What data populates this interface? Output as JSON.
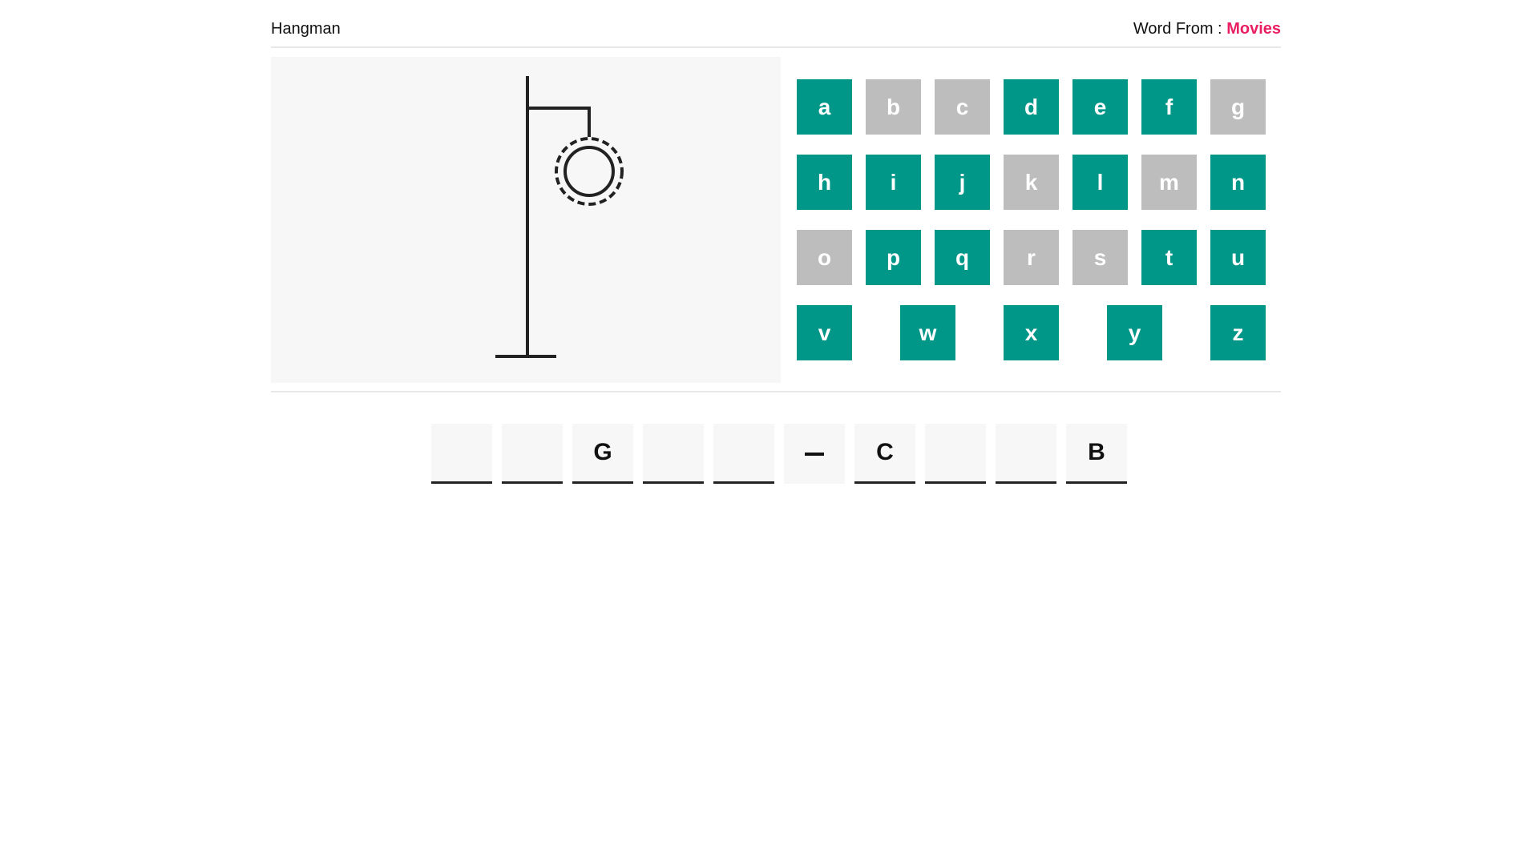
{
  "header": {
    "title": "Hangman",
    "category_label": "Word From :",
    "category_value": "Movies"
  },
  "colors": {
    "key_available": "#009688",
    "key_used": "#bdbdbd",
    "category_accent": "#e91e63",
    "panel_bg": "#f7f7f7",
    "drawing_stroke": "#222222"
  },
  "hangman": {
    "drawn_parts": [
      "base",
      "pole",
      "beam",
      "rope",
      "head"
    ],
    "head_style": "dashed outer ring"
  },
  "keyboard": {
    "rows": [
      [
        {
          "letter": "a",
          "state": "available"
        },
        {
          "letter": "b",
          "state": "used"
        },
        {
          "letter": "c",
          "state": "used"
        },
        {
          "letter": "d",
          "state": "available"
        },
        {
          "letter": "e",
          "state": "available"
        },
        {
          "letter": "f",
          "state": "available"
        },
        {
          "letter": "g",
          "state": "used"
        }
      ],
      [
        {
          "letter": "h",
          "state": "available"
        },
        {
          "letter": "i",
          "state": "available"
        },
        {
          "letter": "j",
          "state": "available"
        },
        {
          "letter": "k",
          "state": "used"
        },
        {
          "letter": "l",
          "state": "available"
        },
        {
          "letter": "m",
          "state": "used"
        },
        {
          "letter": "n",
          "state": "available"
        }
      ],
      [
        {
          "letter": "o",
          "state": "used"
        },
        {
          "letter": "p",
          "state": "available"
        },
        {
          "letter": "q",
          "state": "available"
        },
        {
          "letter": "r",
          "state": "used"
        },
        {
          "letter": "s",
          "state": "used"
        },
        {
          "letter": "t",
          "state": "available"
        },
        {
          "letter": "u",
          "state": "available"
        }
      ],
      [
        {
          "letter": "v",
          "state": "available"
        },
        {
          "letter": "w",
          "state": "available"
        },
        {
          "letter": "x",
          "state": "available"
        },
        {
          "letter": "y",
          "state": "available"
        },
        {
          "letter": "z",
          "state": "available"
        }
      ]
    ]
  },
  "word": {
    "slots": [
      {
        "type": "letter",
        "value": ""
      },
      {
        "type": "letter",
        "value": ""
      },
      {
        "type": "letter",
        "value": "G"
      },
      {
        "type": "letter",
        "value": ""
      },
      {
        "type": "letter",
        "value": ""
      },
      {
        "type": "dash",
        "value": "–"
      },
      {
        "type": "letter",
        "value": "C"
      },
      {
        "type": "letter",
        "value": ""
      },
      {
        "type": "letter",
        "value": ""
      },
      {
        "type": "letter",
        "value": "B"
      }
    ]
  }
}
